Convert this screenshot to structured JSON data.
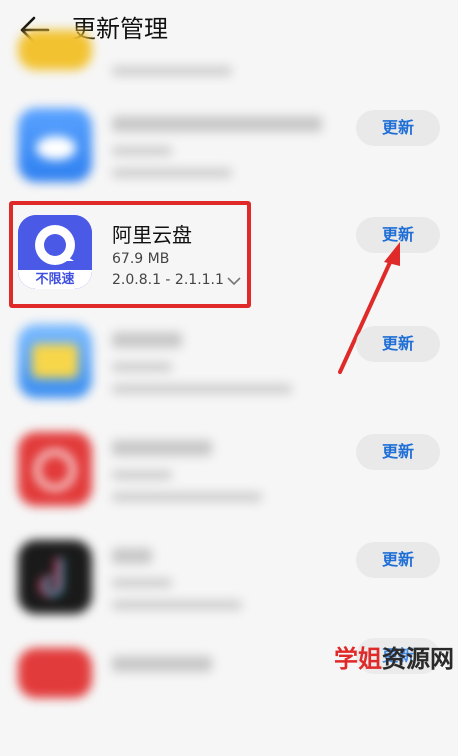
{
  "header": {
    "title": "更新管理"
  },
  "update_label": "更新",
  "featured_app": {
    "name": "阿里云盘",
    "size": "67.9 MB",
    "version": "2.0.8.1 - 2.1.1.1",
    "badge": "不限速"
  },
  "watermark": {
    "part1": "学姐",
    "part2": "资源网"
  },
  "colors": {
    "accent": "#1f6fd6",
    "highlight": "#e02a2a",
    "button_bg": "#e9e9e9"
  }
}
